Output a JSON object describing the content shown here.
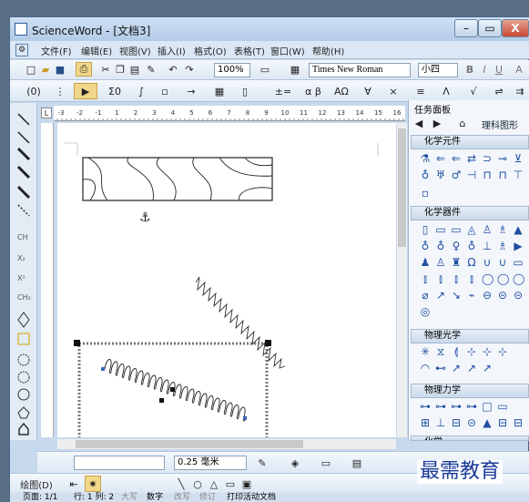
{
  "window": {
    "title": "ScienceWord - [文档3]"
  },
  "controls": {
    "minimize": "–",
    "restore": "▭",
    "close": "X"
  },
  "menu": [
    "文件(F)",
    "编辑(E)",
    "视图(V)",
    "插入(I)",
    "格式(O)",
    "表格(T)",
    "窗口(W)",
    "帮助(H)"
  ],
  "toolbar": {
    "zoom": "100%",
    "font": "Times New Roman",
    "size": "小四",
    "bold": "B",
    "italic": "I",
    "underline": "U",
    "super": "A",
    "cursor": "(0)",
    "sigma": "Σ0",
    "alpha": "α β",
    "omega": "ΑΩ"
  },
  "ruler": {
    "ticks": [
      "-3",
      "-2",
      "-1",
      "1",
      "2",
      "3",
      "4",
      "5",
      "6",
      "7",
      "8",
      "9",
      "10",
      "11",
      "12",
      "13",
      "14",
      "15",
      "16"
    ]
  },
  "panel": {
    "title": "任务面板",
    "nav_label": "理科图形",
    "sections": [
      "化学元件",
      "化学器件",
      "物理光学",
      "物理力学",
      "化学"
    ]
  },
  "bottom": {
    "line_width": "0.25 毫米",
    "draw_label": "绘图(D)"
  },
  "status": {
    "page": "页面: 1/1",
    "pos": "行: 1 列: 2",
    "mode1": "大写",
    "mode2": "数字",
    "mode3": "改写",
    "mode4": "修订",
    "print": "打印活动文档"
  },
  "watermark": "最需教育",
  "colors": {
    "accent": "#3a67b0",
    "panel_bg": "#f3f6fb",
    "chrome": "#c7d9ec"
  }
}
